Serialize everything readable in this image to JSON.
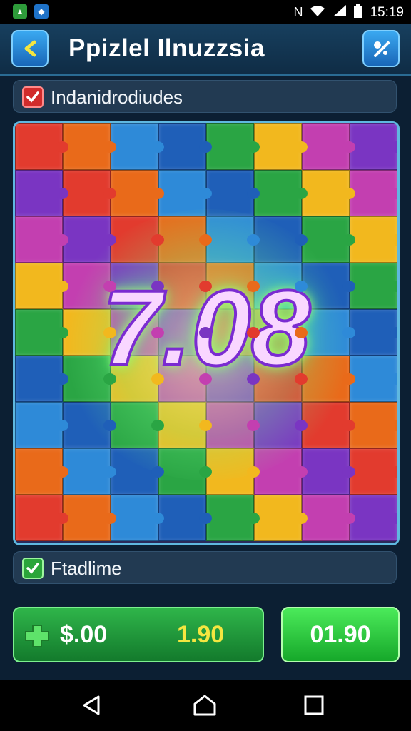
{
  "status_bar": {
    "app_icons": [
      "app-notification-icon",
      "app-notification-icon"
    ],
    "icons": [
      "nfc-icon",
      "wifi-icon",
      "signal-icon",
      "battery-icon"
    ],
    "time": "15:19"
  },
  "app_bar": {
    "title": "Ppizlel Ilnuzzsia"
  },
  "option_row_top": {
    "label": "Indanidrodiudes",
    "checked": true,
    "check_color": "#d12b2b"
  },
  "board": {
    "score": "7.08"
  },
  "option_row_bottom": {
    "label": "Ftadlime",
    "checked": true,
    "check_color": "#2aa53a"
  },
  "purchase_bar": {
    "price": "$.00",
    "amount": "1.90"
  },
  "buy_button": {
    "label": "01.90"
  },
  "colors": {
    "accent_blue": "#3aa8f0",
    "accent_green": "#2fb54a",
    "background": "#0c1f33"
  }
}
